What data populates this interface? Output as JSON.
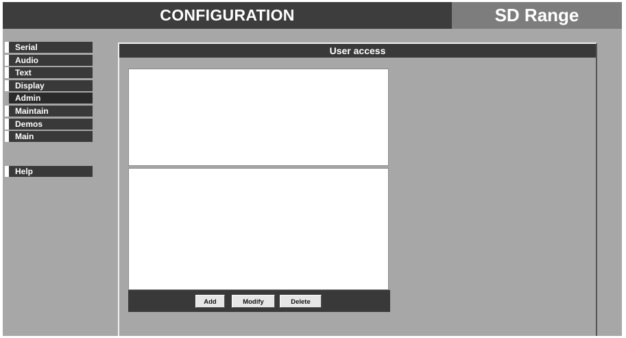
{
  "header": {
    "title": "CONFIGURATION",
    "product": "SD Range"
  },
  "sidebar": {
    "items": [
      {
        "label": "Serial"
      },
      {
        "label": "Audio"
      },
      {
        "label": "Text"
      },
      {
        "label": "Display"
      },
      {
        "label": "Admin",
        "active": true
      },
      {
        "label": "Maintain"
      },
      {
        "label": "Demos"
      },
      {
        "label": "Main"
      }
    ],
    "help_label": "Help"
  },
  "panel": {
    "title": "User access",
    "buttons": {
      "add": "Add",
      "modify": "Modify",
      "delete": "Delete"
    }
  },
  "colors": {
    "background": "#a7a7a7",
    "dark_bar": "#393939",
    "product_badge": "#7d7d7d"
  }
}
